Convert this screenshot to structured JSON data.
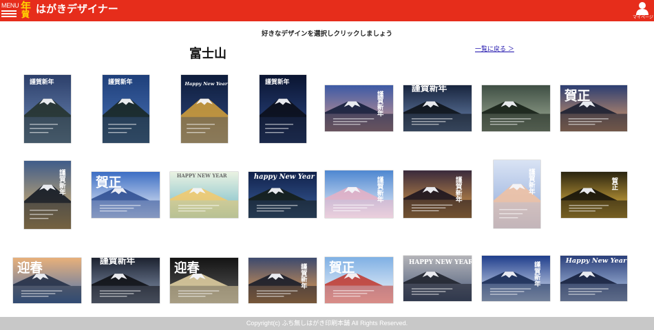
{
  "header": {
    "menu_label": "MENU",
    "logo_text_top": "年",
    "logo_text_bottom": "賀",
    "app_title": "はがきデザイナー",
    "mypage_label": "マイページ"
  },
  "instruction": "好きなデザインを選択しクリックしましょう",
  "page_title": "富士山",
  "back_link": "一覧に戻る ＞",
  "designs": [
    {
      "orientation": "portrait",
      "palette": [
        "#2c3f6a",
        "#6f8bb8",
        "#233028"
      ],
      "heading": "謹賀新年",
      "heading_style": "banner"
    },
    {
      "orientation": "portrait",
      "palette": [
        "#1e3f7a",
        "#4c74b8",
        "#17251d"
      ],
      "heading": "謹賀新年",
      "heading_style": "banner"
    },
    {
      "orientation": "portrait",
      "palette": [
        "#0e1c3b",
        "#2f4a82",
        "#d7a23a"
      ],
      "heading": "Happy New Year",
      "heading_style": "script"
    },
    {
      "orientation": "portrait",
      "palette": [
        "#0a1430",
        "#2f4c8c",
        "#0b0d16"
      ],
      "heading": "謹賀新年",
      "heading_style": "banner"
    },
    {
      "orientation": "landscape",
      "palette": [
        "#3d5aa6",
        "#d69a8e",
        "#0f1a36"
      ],
      "heading": "謹賀新年",
      "heading_style": "vertical"
    },
    {
      "orientation": "landscape",
      "palette": [
        "#18253e",
        "#6d87b1",
        "#0a0f14"
      ],
      "heading": "謹賀新年",
      "heading_style": "banner"
    },
    {
      "orientation": "landscape",
      "palette": [
        "#3f4f44",
        "#a3b09a",
        "#111a12"
      ],
      "heading": "",
      "heading_style": "none"
    },
    {
      "orientation": "landscape",
      "palette": [
        "#2c3e72",
        "#e3a06a",
        "#141b2e"
      ],
      "heading": "賀正",
      "heading_style": "bold"
    },
    {
      "orientation": "portrait",
      "palette": [
        "#3f5c8a",
        "#f3c26a",
        "#0d1420"
      ],
      "heading": "謹賀新年",
      "heading_style": "vertical"
    },
    {
      "orientation": "landscape",
      "palette": [
        "#3d6ec4",
        "#f4f7fb",
        "#2b4b8f"
      ],
      "heading": "賀正",
      "heading_style": "bold"
    },
    {
      "orientation": "landscape",
      "palette": [
        "#eaf2e2",
        "#6fb8c7",
        "#f4c96a"
      ],
      "heading": "HAPPY NEW YEAR",
      "heading_style": "small"
    },
    {
      "orientation": "landscape",
      "palette": [
        "#10214a",
        "#3b5f9c",
        "#141c14"
      ],
      "heading": "happy New Year",
      "heading_style": "script"
    },
    {
      "orientation": "landscape",
      "palette": [
        "#4e87d1",
        "#f2f5fa",
        "#e6b0c4"
      ],
      "heading": "謹賀新年",
      "heading_style": "vertical"
    },
    {
      "orientation": "landscape",
      "palette": [
        "#3a2a3c",
        "#e2a24b",
        "#16101c"
      ],
      "heading": "謹賀新年",
      "heading_style": "vertical"
    },
    {
      "orientation": "portrait",
      "palette": [
        "#d9e3f4",
        "#8aa6d8",
        "#f2c1a0"
      ],
      "heading": "謹賀新年",
      "heading_style": "vertical"
    },
    {
      "orientation": "landscape",
      "palette": [
        "#2a2410",
        "#f4c446",
        "#0e0d08"
      ],
      "heading": "賀正",
      "heading_style": "vertical"
    },
    {
      "orientation": "landscape",
      "palette": [
        "#e8b07a",
        "#4a72ad",
        "#1e2c44"
      ],
      "heading": "迎春",
      "heading_style": "bold"
    },
    {
      "orientation": "landscape",
      "palette": [
        "#1c2230",
        "#8b9bb6",
        "#0c0d10"
      ],
      "heading": "謹賀新年",
      "heading_style": "banner"
    },
    {
      "orientation": "landscape",
      "palette": [
        "#141414",
        "#5a5a5a",
        "#e8d6a6"
      ],
      "heading": "迎春",
      "heading_style": "bold"
    },
    {
      "orientation": "landscape",
      "palette": [
        "#3d4a6e",
        "#f0a250",
        "#121826"
      ],
      "heading": "謹賀新年",
      "heading_style": "vertical"
    },
    {
      "orientation": "landscape",
      "palette": [
        "#7fb0e4",
        "#f5f7fa",
        "#c1352a"
      ],
      "heading": "賀正",
      "heading_style": "bold"
    },
    {
      "orientation": "landscape",
      "palette": [
        "#b4b4b8",
        "#4a5a7a",
        "#1b1e28"
      ],
      "heading": "HAPPY NEW YEAR",
      "heading_style": "arc"
    },
    {
      "orientation": "landscape",
      "palette": [
        "#1f3e8c",
        "#e6eef8",
        "#13264f"
      ],
      "heading": "謹賀新年",
      "heading_style": "vertical"
    },
    {
      "orientation": "landscape",
      "palette": [
        "#2a3f7a",
        "#bcd0ee",
        "#101a36"
      ],
      "heading": "Happy New Year",
      "heading_style": "script"
    }
  ],
  "footer": "Copyright(c) ふち無しはがき印刷本舗 All Rights Reserved."
}
